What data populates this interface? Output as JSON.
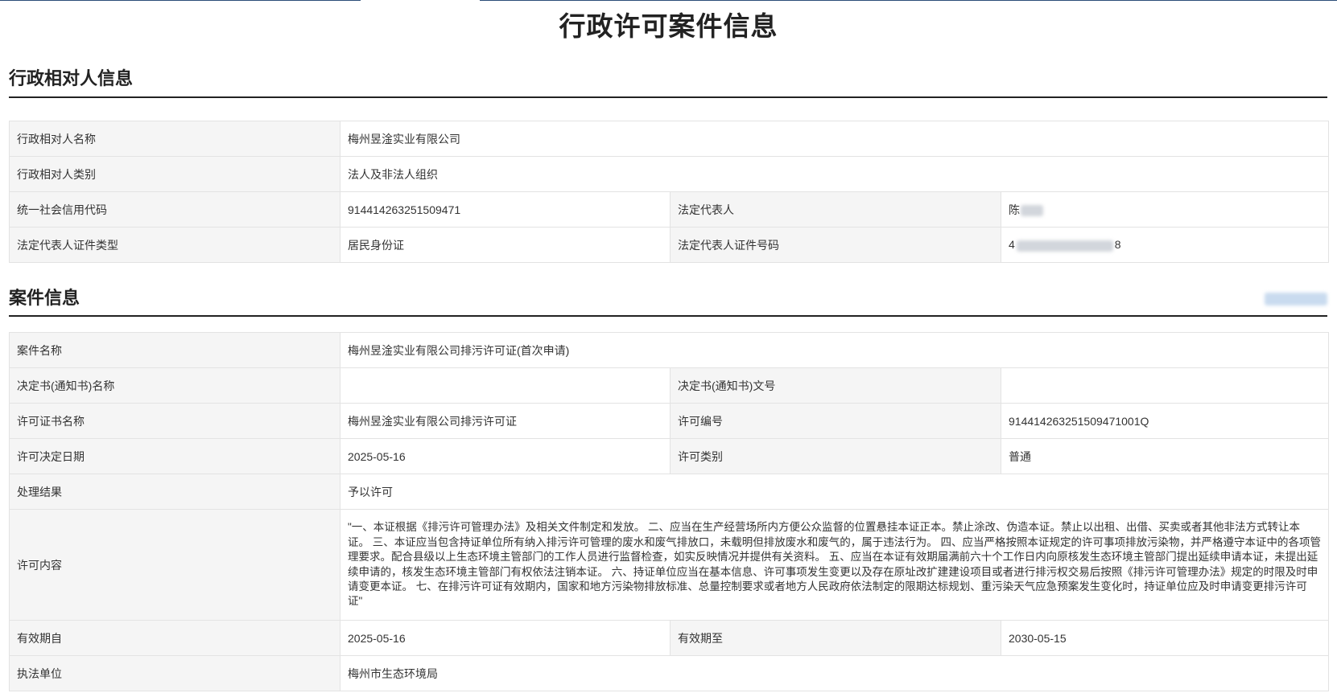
{
  "page_title": "行政许可案件信息",
  "section_party": {
    "title": "行政相对人信息",
    "party_name_label": "行政相对人名称",
    "party_name": "梅州昱淦实业有限公司",
    "party_type_label": "行政相对人类别",
    "party_type": "法人及非法人组织",
    "credit_code_label": "统一社会信用代码",
    "credit_code": "914414263251509471",
    "legal_rep_label": "法定代表人",
    "legal_rep_visible": "陈",
    "id_type_label": "法定代表人证件类型",
    "id_type": "居民身份证",
    "id_number_label": "法定代表人证件号码",
    "id_number_prefix": "4",
    "id_number_suffix": "8"
  },
  "section_case": {
    "title": "案件信息",
    "case_name_label": "案件名称",
    "case_name": "梅州昱淦实业有限公司排污许可证(首次申请)",
    "decision_name_label": "决定书(通知书)名称",
    "decision_name": "",
    "decision_no_label": "决定书(通知书)文号",
    "decision_no": "",
    "license_name_label": "许可证书名称",
    "license_name": "梅州昱淦实业有限公司排污许可证",
    "license_no_label": "许可编号",
    "license_no": "914414263251509471001Q",
    "decision_date_label": "许可决定日期",
    "decision_date": "2025-05-16",
    "license_category_label": "许可类别",
    "license_category": "普通",
    "result_label": "处理结果",
    "result": "予以许可",
    "content_label": "许可内容",
    "content": "\"一、本证根据《排污许可管理办法》及相关文件制定和发放。 二、应当在生产经营场所内方便公众监督的位置悬挂本证正本。禁止涂改、伪造本证。禁止以出租、出借、买卖或者其他非法方式转让本证。 三、本证应当包含持证单位所有纳入排污许可管理的废水和废气排放口，未载明但排放废水和废气的，属于违法行为。 四、应当严格按照本证规定的许可事项排放污染物，并严格遵守本证中的各项管理要求。配合县级以上生态环境主管部门的工作人员进行监督检查，如实反映情况并提供有关资料。 五、应当在本证有效期届满前六十个工作日内向原核发生态环境主管部门提出延续申请本证，未提出延续申请的，核发生态环境主管部门有权依法注销本证。 六、持证单位应当在基本信息、许可事项发生变更以及存在原址改扩建建设项目或者进行排污权交易后按照《排污许可管理办法》规定的时限及时申请变更本证。 七、在排污许可证有效期内，国家和地方污染物排放标准、总量控制要求或者地方人民政府依法制定的限期达标规划、重污染天气应急预案发生变化时，持证单位应及时申请变更排污许可证\"",
    "valid_from_label": "有效期自",
    "valid_from": "2025-05-16",
    "valid_to_label": "有效期至",
    "valid_to": "2030-05-15",
    "authority_label": "执法单位",
    "authority": "梅州市生态环境局"
  }
}
